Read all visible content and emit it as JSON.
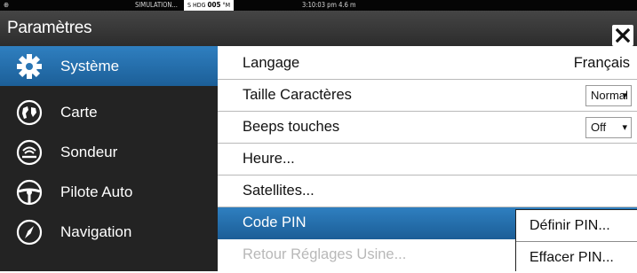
{
  "status": {
    "gps_icon": "gps-signal-icon",
    "simulation": "SIMULATION...",
    "heading_prefix": "S HDG ",
    "heading_value": "005",
    "heading_unit": " °M",
    "time": "3:10:03 pm  4.6 m"
  },
  "title": "Paramètres",
  "sidebar": {
    "items": [
      {
        "label": "Système",
        "icon": "gear-icon"
      },
      {
        "label": "Carte",
        "icon": "chart-map-icon"
      },
      {
        "label": "Sondeur",
        "icon": "sonar-icon"
      },
      {
        "label": "Pilote Auto",
        "icon": "steering-wheel-icon"
      },
      {
        "label": "Navigation",
        "icon": "compass-icon"
      }
    ]
  },
  "settings": {
    "rows": [
      {
        "label": "Langage",
        "value": "Français"
      },
      {
        "label": "Taille Caractères",
        "value": "Normal"
      },
      {
        "label": "Beeps touches",
        "value": "Off"
      },
      {
        "label": "Heure..."
      },
      {
        "label": "Satellites..."
      },
      {
        "label": "Code PIN"
      },
      {
        "label": "Retour Réglages Usine..."
      }
    ]
  },
  "popup": {
    "items": [
      {
        "label": "Définir PIN..."
      },
      {
        "label": "Effacer PIN..."
      }
    ]
  },
  "colors": {
    "accent": "#2674b3",
    "sidebar_bg": "#232323",
    "titlebar_bg": "#383838"
  }
}
